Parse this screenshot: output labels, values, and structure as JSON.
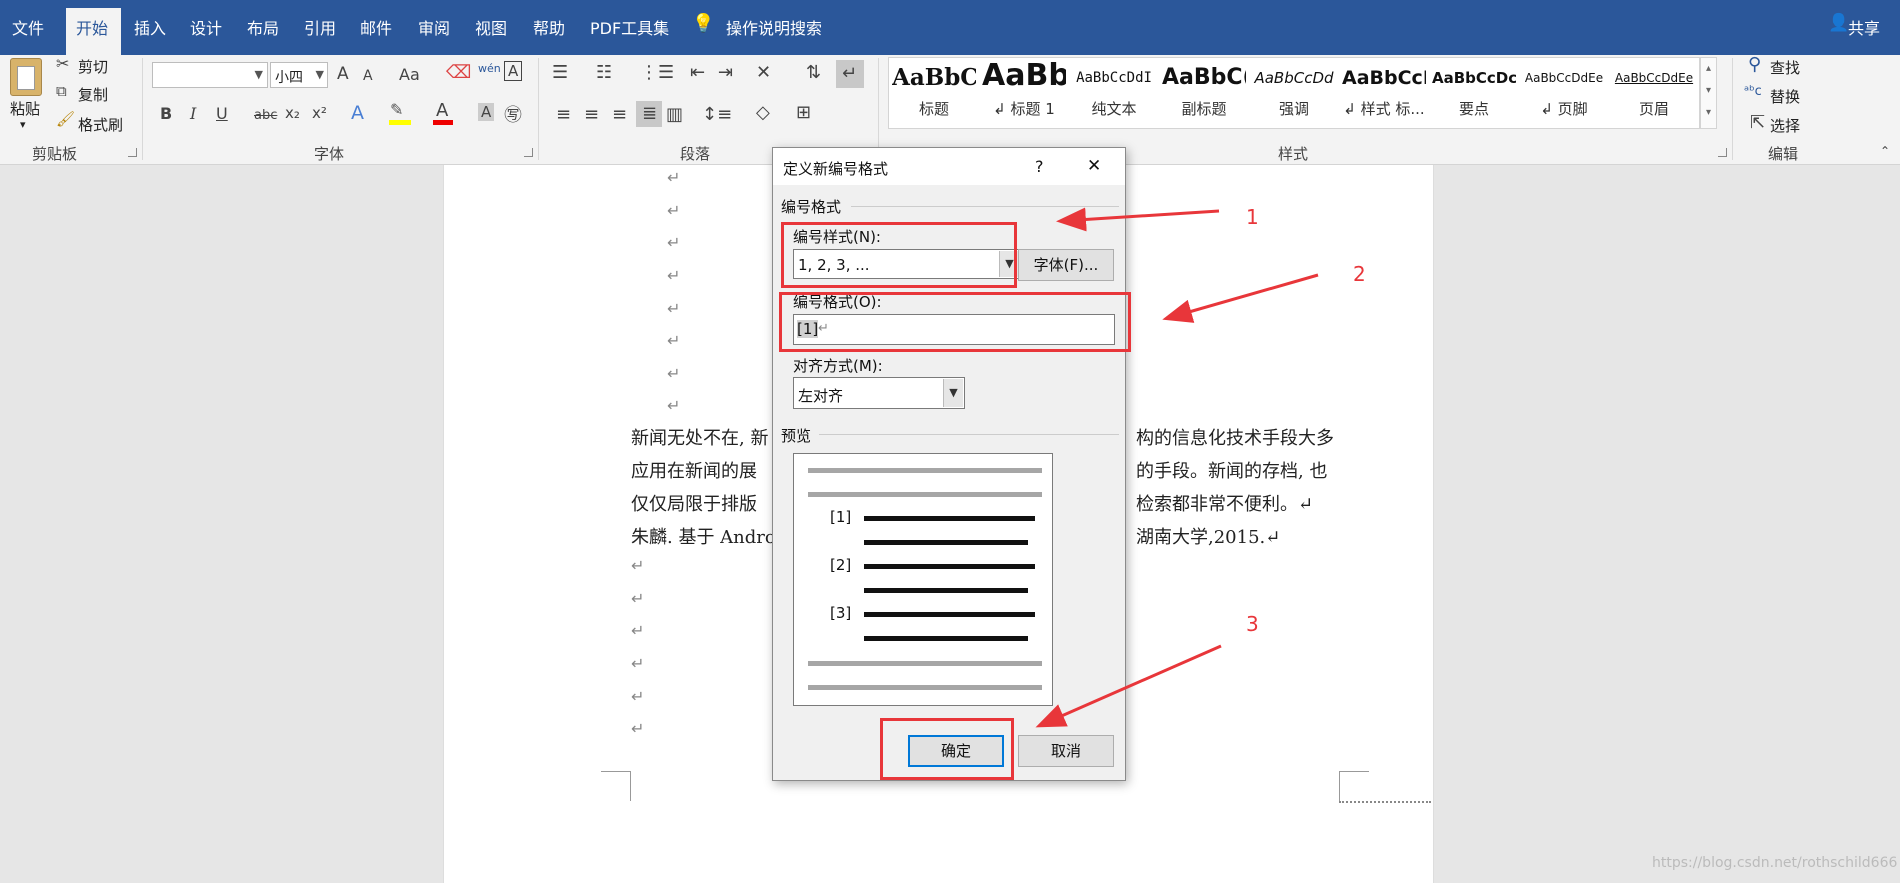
{
  "tabs": {
    "file": "文件",
    "home": "开始",
    "insert": "插入",
    "design": "设计",
    "layout": "布局",
    "references": "引用",
    "mailings": "邮件",
    "review": "审阅",
    "view": "视图",
    "help": "帮助",
    "pdf": "PDF工具集",
    "search": "操作说明搜索",
    "share": "共享"
  },
  "clipboard": {
    "paste": "粘贴",
    "cut": "剪切",
    "copy": "复制",
    "format_painter": "格式刷",
    "group": "剪贴板"
  },
  "font": {
    "name": "",
    "size": "小四",
    "group": "字体",
    "bold": "B",
    "italic": "I",
    "underline": "U",
    "strike": "abc",
    "sub": "x₂",
    "sup": "x²",
    "grow": "A",
    "shrink": "A",
    "case": "Aa",
    "phonetic": "wén"
  },
  "paragraph": {
    "group": "段落"
  },
  "styles": {
    "group": "样式",
    "items": [
      {
        "preview": "AaBbC(",
        "label": "标题"
      },
      {
        "preview": "AaBb",
        "label": "↲ 标题 1"
      },
      {
        "preview": "AaBbCcDdI",
        "label": "纯文本"
      },
      {
        "preview": "AaBbC(",
        "label": "副标题"
      },
      {
        "preview": "AaBbCcDd",
        "label": "强调"
      },
      {
        "preview": "AaBbCcI",
        "label": "↲ 样式 标..."
      },
      {
        "preview": "AaBbCcDc",
        "label": "要点"
      },
      {
        "preview": "AaBbCcDdEe",
        "label": "↲ 页脚"
      },
      {
        "preview": "AaBbCcDdEe",
        "label": "页眉"
      }
    ]
  },
  "editing": {
    "find": "查找",
    "replace": "替换",
    "select": "选择",
    "group": "编辑"
  },
  "doc": {
    "mark": "↵",
    "lines": [
      "新闻无处不在, 新",
      "应用在新闻的展",
      "仅仅局限于排版",
      "朱麟. 基于 Andro"
    ],
    "lines_right": [
      "构的信息化技术手段大多",
      "的手段。新闻的存档, 也",
      "检索都非常不便利。↵",
      "湖南大学,2015.↵"
    ]
  },
  "dialog": {
    "title": "定义新编号格式",
    "help": "?",
    "close": "✕",
    "section_format": "编号格式",
    "style_label": "编号样式(N):",
    "style_value": "1, 2, 3, ...",
    "font_button": "字体(F)...",
    "format_label": "编号格式(O):",
    "format_value": "[1]",
    "align_label": "对齐方式(M):",
    "align_value": "左对齐",
    "preview_label": "预览",
    "preview_items": [
      "[1]",
      "[2]",
      "[3]"
    ],
    "ok": "确定",
    "cancel": "取消"
  },
  "annotations": {
    "n1": "1",
    "n2": "2",
    "n3": "3"
  },
  "watermark": "https://blog.csdn.net/rothschild666",
  "colors": {
    "ribbon_blue": "#2b579a",
    "annotation_red": "#e8363a",
    "accent_blue": "#0078d7"
  }
}
